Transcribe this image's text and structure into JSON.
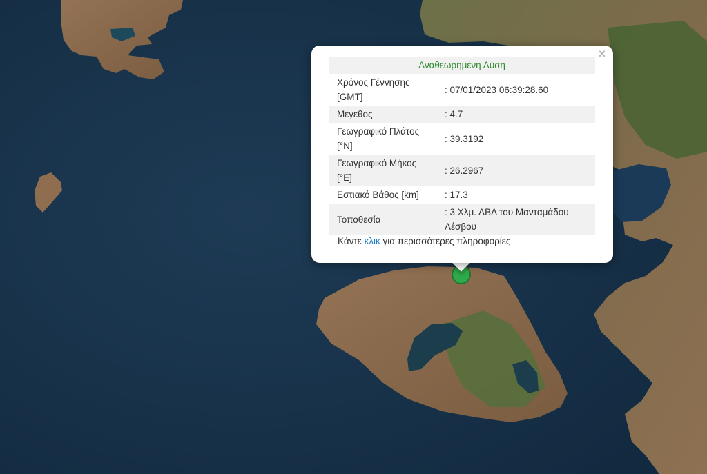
{
  "popup": {
    "title": "Αναθεωρημένη Λύση",
    "close_icon": "×",
    "rows": [
      {
        "label": "Χρόνος Γέννησης [GMT]",
        "value": ": 07/01/2023 06:39:28.60"
      },
      {
        "label": "Μέγεθος",
        "value": ": 4.7"
      },
      {
        "label": "Γεωγραφικό Πλάτος [°N]",
        "value": ": 39.3192"
      },
      {
        "label": "Γεωγραφικό Μήκος [°E]",
        "value": ": 26.2967"
      },
      {
        "label": "Εστιακό Βάθος [km]",
        "value": ": 17.3"
      },
      {
        "label": "Τοποθεσία",
        "value": ": 3 Χλμ. ΔΒΔ του Μανταμάδου Λέσβου"
      }
    ],
    "more_prefix": "Κάντε ",
    "more_link": "κλικ",
    "more_suffix": " για περισσότερες πληροφορίες"
  },
  "colors": {
    "sea": "#18324a",
    "land": "#8a6a4a",
    "forest": "#4f6b38",
    "marker": "#2faa4a",
    "title_green": "#2e8b2e",
    "link_blue": "#1a7fc4"
  }
}
